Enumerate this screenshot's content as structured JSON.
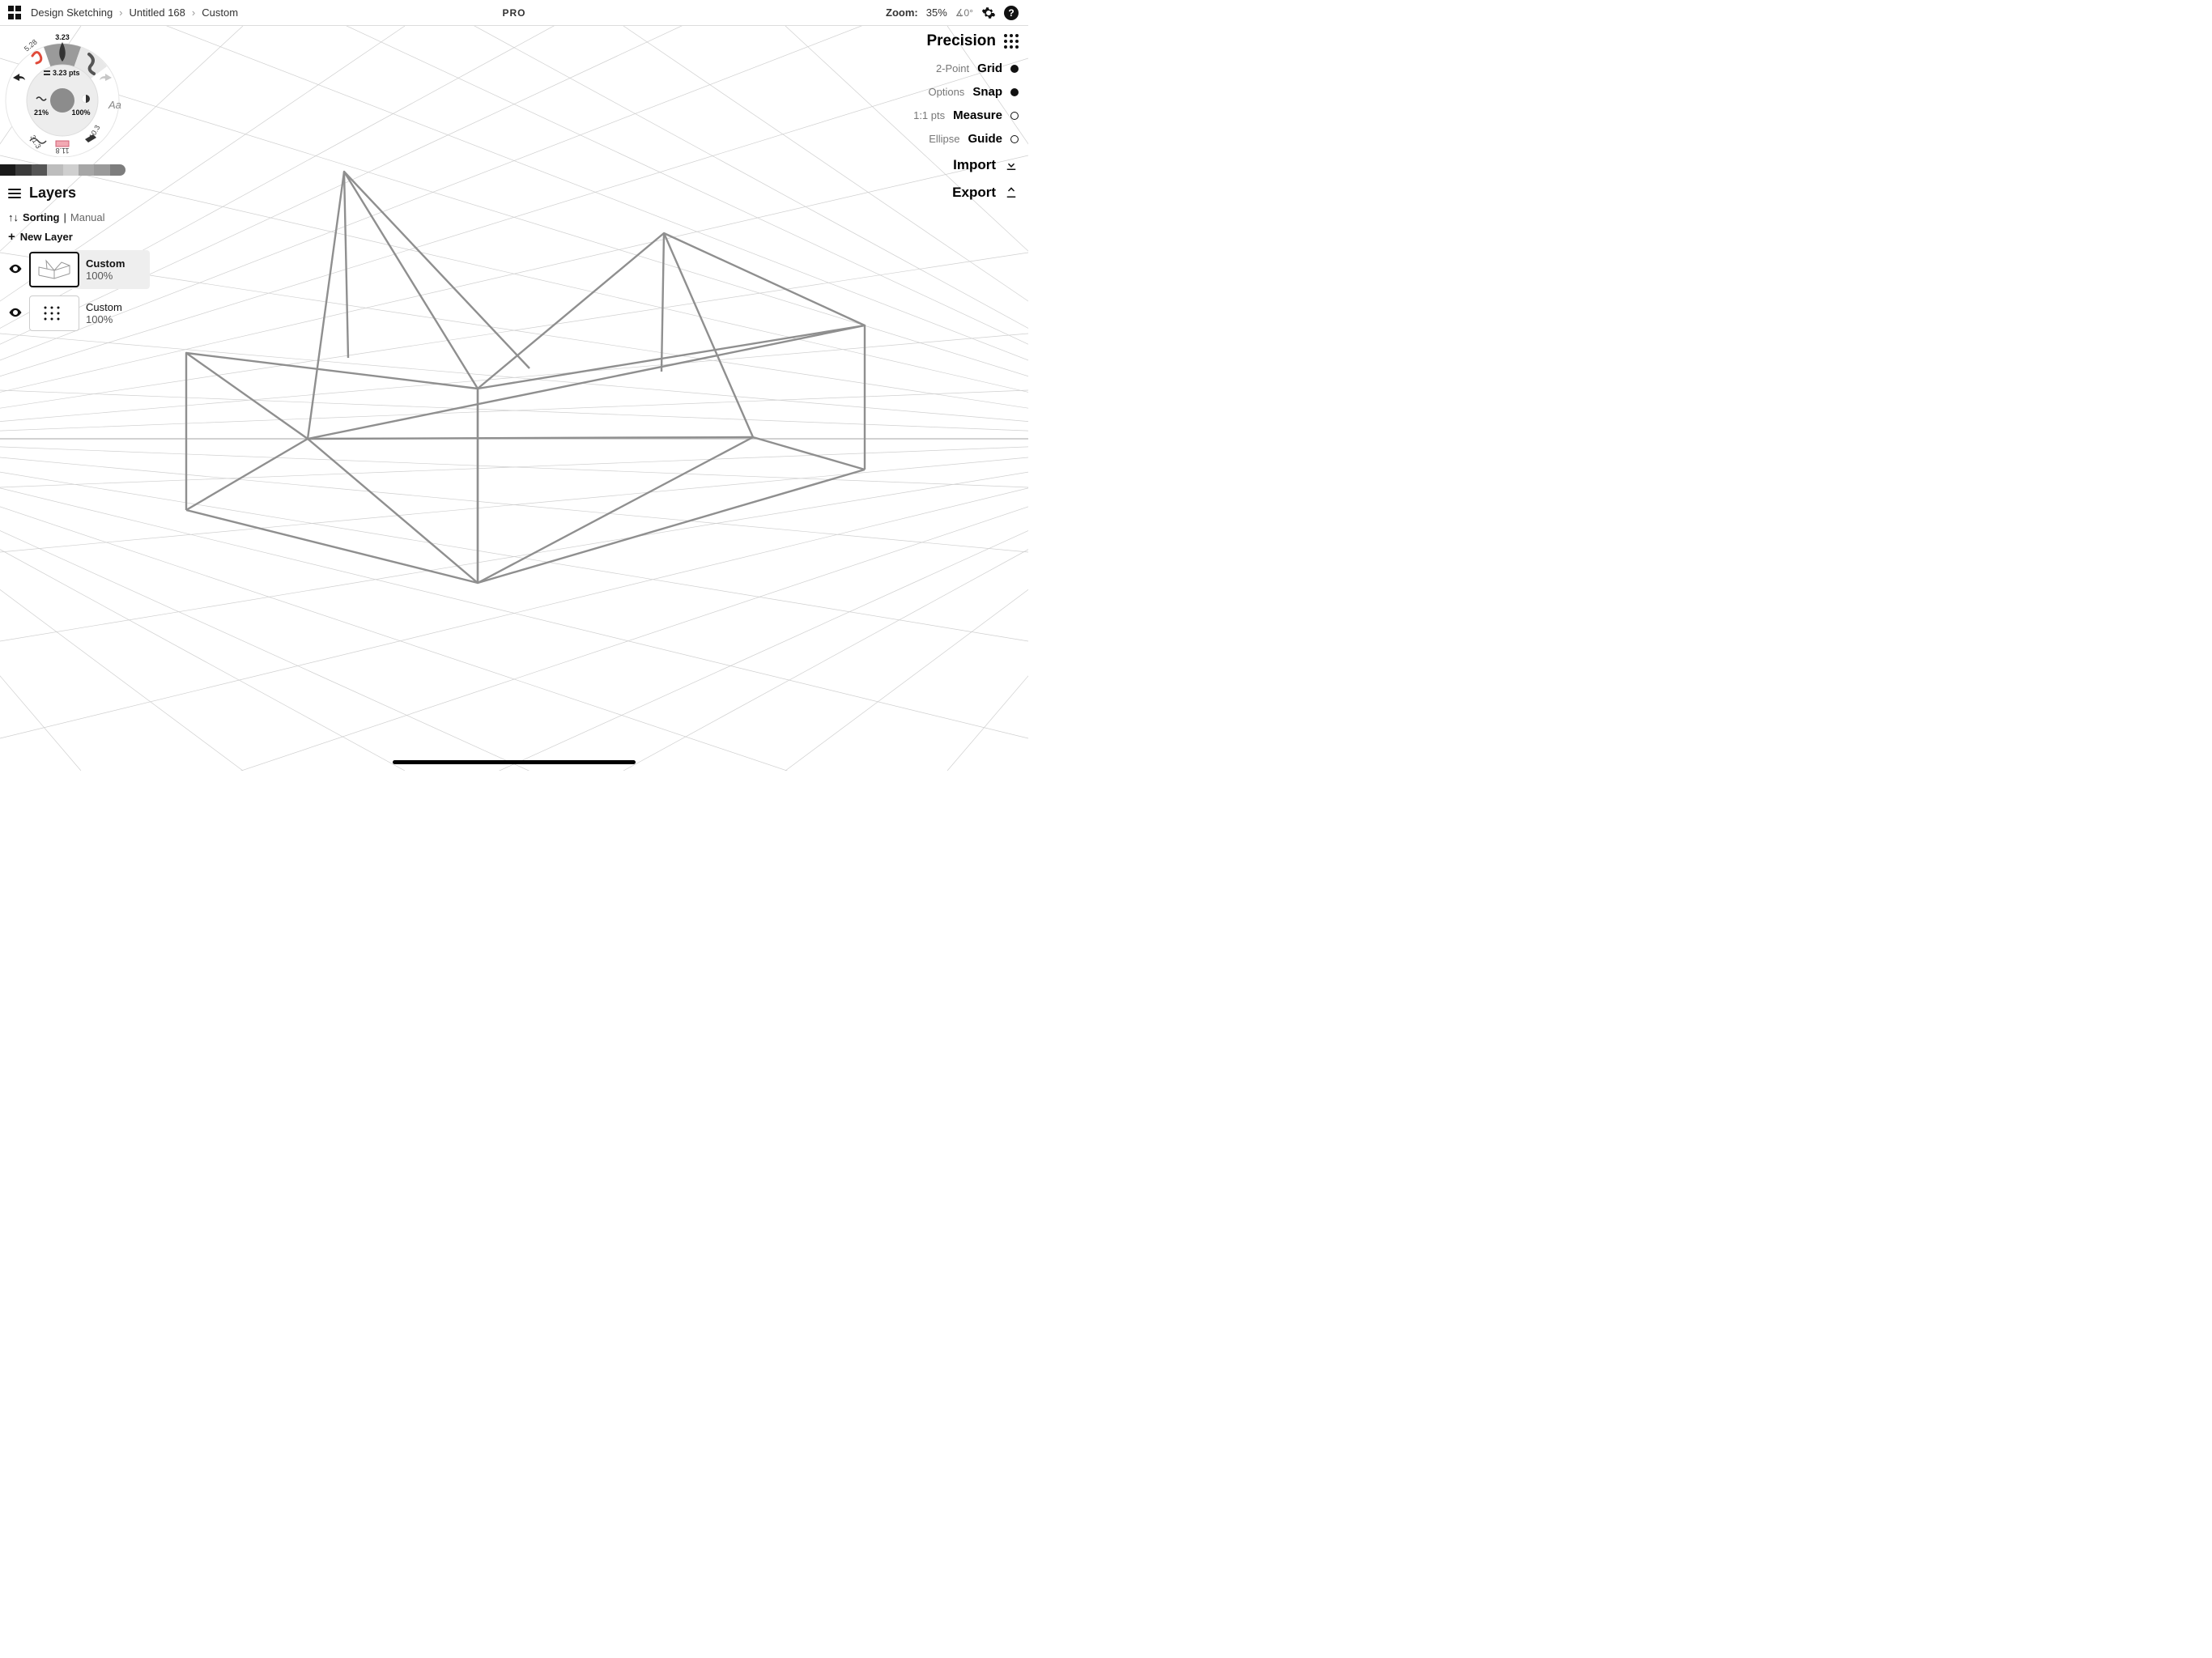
{
  "topbar": {
    "breadcrumbs": [
      "Design Sketching",
      "Untitled 168",
      "Custom"
    ],
    "center_badge": "PRO",
    "zoom_label": "Zoom:",
    "zoom_value": "35%",
    "angle_value": "∡0°"
  },
  "wheel": {
    "active_size": "3.23",
    "size_pts": "3.23 pts",
    "flow": "21%",
    "opacity": "100%",
    "presets": [
      "5.28",
      "31.3",
      "11.8",
      "10.3"
    ]
  },
  "colors": [
    "#1a1a1a",
    "#3a3a3a",
    "#555555",
    "#bdbdbd",
    "#cfcfcf",
    "#a6a6a6",
    "#9a9a9a",
    "#7d7d7d"
  ],
  "layers": {
    "title": "Layers",
    "sorting_label": "Sorting",
    "sorting_mode": "Manual",
    "new_layer": "New Layer",
    "items": [
      {
        "name": "Custom",
        "opacity": "100%",
        "active": true,
        "type": "drawing"
      },
      {
        "name": "Custom",
        "opacity": "100%",
        "active": false,
        "type": "grid"
      }
    ]
  },
  "precision": {
    "title": "Precision",
    "rows": [
      {
        "dim": "2-Point",
        "main": "Grid",
        "state": "on"
      },
      {
        "dim": "Options",
        "main": "Snap",
        "state": "on"
      },
      {
        "dim": "1:1 pts",
        "main": "Measure",
        "state": "off"
      },
      {
        "dim": "Ellipse",
        "main": "Guide",
        "state": "off"
      }
    ],
    "import": "Import",
    "export": "Export"
  }
}
